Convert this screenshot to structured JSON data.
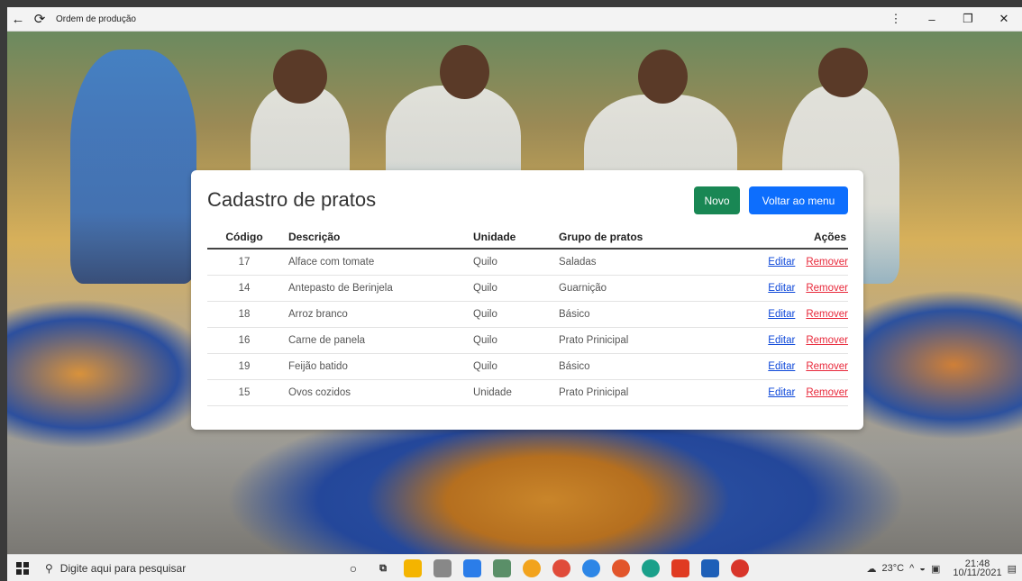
{
  "window": {
    "title": "Ordem de produção",
    "back_icon": "←",
    "reload_icon": "⟳",
    "menu_icon": "⋮",
    "minimize_icon": "–",
    "restore_icon": "❐",
    "close_icon": "✕"
  },
  "card": {
    "title": "Cadastro de pratos",
    "btn_new": "Novo",
    "btn_back": "Voltar ao menu",
    "headers": {
      "code": "Código",
      "description": "Descrição",
      "unit": "Unidade",
      "group": "Grupo de pratos",
      "actions": "Ações"
    },
    "rows": [
      {
        "code": "17",
        "description": "Alface com tomate",
        "unit": "Quilo",
        "group": "Saladas",
        "edit": "Editar",
        "remove": "Remover"
      },
      {
        "code": "14",
        "description": "Antepasto de Berinjela",
        "unit": "Quilo",
        "group": "Guarnição",
        "edit": "Editar",
        "remove": "Remover"
      },
      {
        "code": "18",
        "description": "Arroz branco",
        "unit": "Quilo",
        "group": "Básico",
        "edit": "Editar",
        "remove": "Remover"
      },
      {
        "code": "16",
        "description": "Carne de panela",
        "unit": "Quilo",
        "group": "Prato Prinicipal",
        "edit": "Editar",
        "remove": "Remover"
      },
      {
        "code": "19",
        "description": "Feijão batido",
        "unit": "Quilo",
        "group": "Básico",
        "edit": "Editar",
        "remove": "Remover"
      },
      {
        "code": "15",
        "description": "Ovos cozidos",
        "unit": "Unidade",
        "group": "Prato Prinicipal",
        "edit": "Editar",
        "remove": "Remover"
      }
    ]
  },
  "taskbar": {
    "search_placeholder": "Digite aqui para pesquisar",
    "weather": "23°C",
    "time": "21:48",
    "date": "10/11/2021"
  },
  "colors": {
    "btn_new": "#198754",
    "btn_back": "#0d6efd",
    "link_edit": "#0d47d9",
    "link_remove": "#e8283a"
  }
}
